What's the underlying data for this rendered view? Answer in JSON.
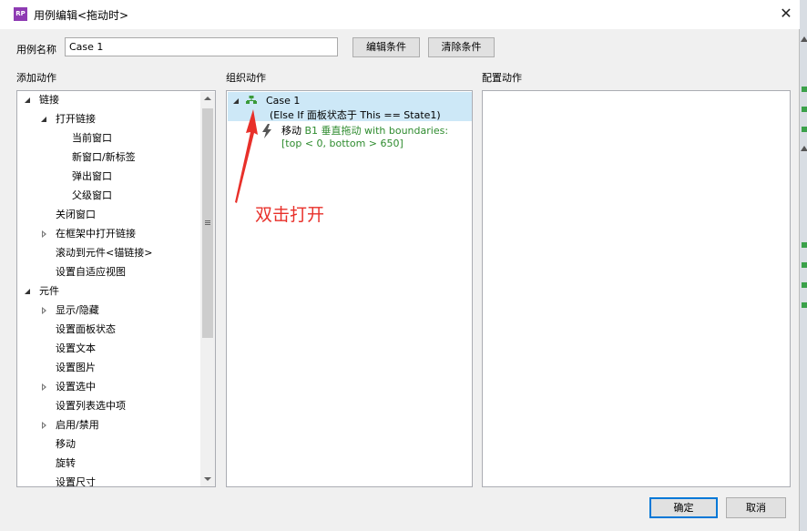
{
  "window": {
    "title": "用例编辑<拖动时>",
    "app_icon_text": "RP"
  },
  "case_name": {
    "label": "用例名称",
    "value": "Case 1"
  },
  "buttons": {
    "edit_condition": "编辑条件",
    "clear_condition": "清除条件",
    "ok": "确定",
    "cancel": "取消"
  },
  "columns": {
    "add_action": "添加动作",
    "organize_action": "组织动作",
    "configure_action": "配置动作"
  },
  "tree": [
    {
      "label": "链接",
      "level": 0,
      "toggle": "open"
    },
    {
      "label": "打开链接",
      "level": 1,
      "toggle": "open"
    },
    {
      "label": "当前窗口",
      "level": 2,
      "toggle": "none"
    },
    {
      "label": "新窗口/新标签",
      "level": 2,
      "toggle": "none"
    },
    {
      "label": "弹出窗口",
      "level": 2,
      "toggle": "none"
    },
    {
      "label": "父级窗口",
      "level": 2,
      "toggle": "none"
    },
    {
      "label": "关闭窗口",
      "level": 1,
      "toggle": "none"
    },
    {
      "label": "在框架中打开链接",
      "level": 1,
      "toggle": "closed"
    },
    {
      "label": "滚动到元件<锚链接>",
      "level": 1,
      "toggle": "none"
    },
    {
      "label": "设置自适应视图",
      "level": 1,
      "toggle": "none"
    },
    {
      "label": "元件",
      "level": 0,
      "toggle": "open"
    },
    {
      "label": "显示/隐藏",
      "level": 1,
      "toggle": "closed"
    },
    {
      "label": "设置面板状态",
      "level": 1,
      "toggle": "none"
    },
    {
      "label": "设置文本",
      "level": 1,
      "toggle": "none"
    },
    {
      "label": "设置图片",
      "level": 1,
      "toggle": "none"
    },
    {
      "label": "设置选中",
      "level": 1,
      "toggle": "closed"
    },
    {
      "label": "设置列表选中项",
      "level": 1,
      "toggle": "none"
    },
    {
      "label": "启用/禁用",
      "level": 1,
      "toggle": "closed"
    },
    {
      "label": "移动",
      "level": 1,
      "toggle": "none"
    },
    {
      "label": "旋转",
      "level": 1,
      "toggle": "none"
    },
    {
      "label": "设置尺寸",
      "level": 1,
      "toggle": "none"
    }
  ],
  "case": {
    "name": "Case 1",
    "condition": "(Else If 面板状态于 This == State1)",
    "action_verb": "移动",
    "action_detail": "B1 垂直拖动 with boundaries: [top < 0, bottom > 650]"
  },
  "annotation": {
    "text": "双击打开",
    "color": "#e8302a"
  },
  "colors": {
    "selection": "#cde8f7",
    "action_green": "#2e8b2e",
    "primary_border": "#0078d7"
  }
}
